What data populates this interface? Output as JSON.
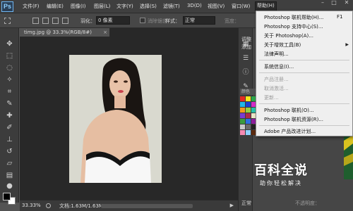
{
  "app": {
    "logo": "Ps"
  },
  "menubar": {
    "items": [
      "文件(F)",
      "编辑(E)",
      "图像(I)",
      "图层(L)",
      "文字(Y)",
      "选择(S)",
      "滤镜(T)",
      "3D(D)",
      "视图(V)",
      "窗口(W)",
      "帮助(H)"
    ],
    "window_controls": [
      "–",
      "□",
      "✕"
    ]
  },
  "options": {
    "feather_label": "羽化：",
    "feather_value": "0 像素",
    "antialias_label": "消除锯齿",
    "style_label": "样式：",
    "style_value": "正常",
    "width_label": "宽度："
  },
  "document": {
    "tab_title": "timg.jpg @ 33.3%(RGB/8#)",
    "close_glyph": "×"
  },
  "status": {
    "zoom": "33.33%",
    "doc_info": "文档:1.63M/1.63M",
    "arrow": "▶"
  },
  "panels": {
    "adjust_label": "调整",
    "add_label": "添加",
    "color_tab": "颜色",
    "layers_label": "图层",
    "mode_value": "正常",
    "opacity_label": "不透明度："
  },
  "help_menu": {
    "items": [
      {
        "label": "Photoshop 联机帮助(H)...",
        "shortcut": "F1",
        "enabled": true
      },
      {
        "label": "Photoshop 支持中心(S)...",
        "enabled": true
      },
      {
        "label": "关于 Photoshop(A)...",
        "enabled": true
      },
      {
        "label": "关于增效工具(B)",
        "submenu": true,
        "enabled": true
      },
      {
        "label": "法律声明...",
        "enabled": true
      },
      {
        "label": "系统信息(I)...",
        "enabled": true
      },
      {
        "label": "产品注册...",
        "enabled": false
      },
      {
        "label": "取消激活...",
        "enabled": false
      },
      {
        "label": "更新...",
        "enabled": false
      },
      {
        "label": "Photoshop 联机(O)...",
        "enabled": true
      },
      {
        "label": "Photoshop 联机资源(R)...",
        "enabled": true
      },
      {
        "label": "Adobe 产品改进计划...",
        "enabled": true
      }
    ]
  },
  "watermark": {
    "title": "百科全说",
    "subtitle": "助你轻松解决"
  },
  "swatch_colors": [
    "#e32b22",
    "#f7e81c",
    "#2ba84a",
    "#1fb6e8",
    "#1d3fd1",
    "#d52bc8",
    "#f29a1e",
    "#97d13b",
    "#27c1a8",
    "#7a3bd1",
    "#ad2b47",
    "#eae6c5",
    "#3a9c3d",
    "#2d6fe0",
    "#8e1e9b",
    "#c9c9c9",
    "#6b6b6b",
    "#222222",
    "#f58ab3",
    "#8fd0ff",
    "#5b2a0f"
  ]
}
